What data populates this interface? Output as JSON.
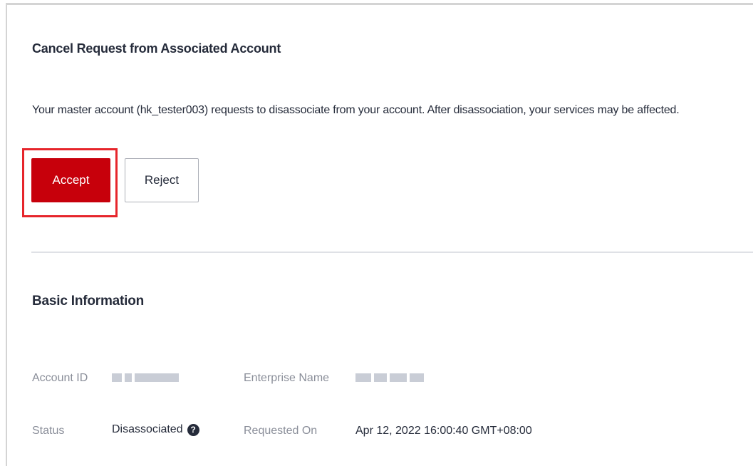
{
  "panel": {
    "title": "Cancel Request from Associated Account",
    "message": "Your master account (hk_tester003) requests to disassociate from your account. After disassociation, your services may be affected.",
    "accept_label": "Accept",
    "reject_label": "Reject"
  },
  "basic_info": {
    "title": "Basic Information",
    "account_id_label": "Account ID",
    "enterprise_name_label": "Enterprise Name",
    "status_label": "Status",
    "status_value": "Disassociated",
    "requested_on_label": "Requested On",
    "requested_on_value": "Apr 12, 2022 16:00:40 GMT+08:00"
  },
  "icons": {
    "status_help": "question-circle-icon",
    "help_glyph": "?"
  },
  "colors": {
    "accept_bg": "#c7000b",
    "highlight": "#e6252b"
  }
}
